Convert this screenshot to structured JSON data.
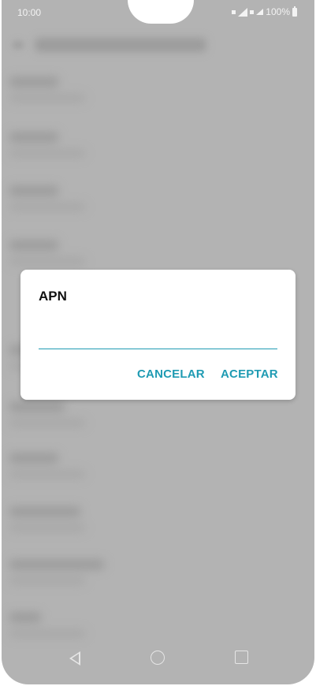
{
  "status_bar": {
    "time": "10:00",
    "battery_text": "100%"
  },
  "dialog": {
    "title": "APN",
    "input_value": "",
    "cancel_label": "CANCELAR",
    "accept_label": "ACEPTAR"
  },
  "colors": {
    "accent": "#1f9bb3",
    "scrim": "#b3b3b3"
  },
  "nav_icons": [
    "back-icon",
    "home-icon",
    "recents-icon"
  ]
}
